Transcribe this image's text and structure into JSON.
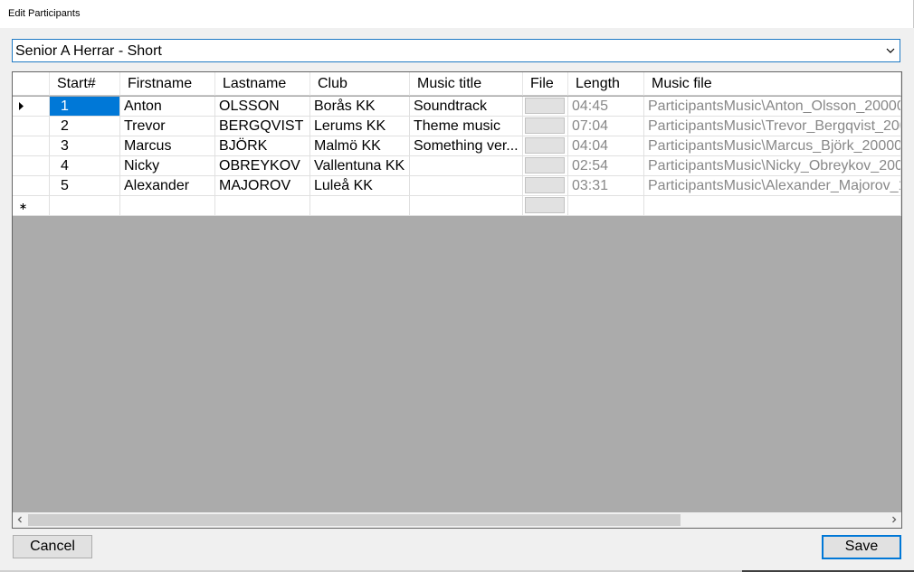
{
  "window": {
    "title": "Edit Participants"
  },
  "category": {
    "selected": "Senior A Herrar - Short"
  },
  "grid": {
    "columns": [
      "Start#",
      "Firstname",
      "Lastname",
      "Club",
      "Music title",
      "File",
      "Length",
      "Music file"
    ],
    "rows": [
      {
        "start": "1",
        "first": "Anton",
        "last": "OLSSON",
        "club": "Borås KK",
        "music_title": "Soundtrack",
        "length": "04:45",
        "music_file": "ParticipantsMusic\\Anton_Olsson_20000"
      },
      {
        "start": "2",
        "first": "Trevor",
        "last": "BERGQVIST",
        "club": "Lerums KK",
        "music_title": "Theme music",
        "length": "07:04",
        "music_file": "ParticipantsMusic\\Trevor_Bergqvist_200"
      },
      {
        "start": "3",
        "first": "Marcus",
        "last": "BJÖRK",
        "club": "Malmö KK",
        "music_title": "Something ver...",
        "length": "04:04",
        "music_file": "ParticipantsMusic\\Marcus_Björk_20000"
      },
      {
        "start": "4",
        "first": "Nicky",
        "last": "OBREYKOV",
        "club": "Vallentuna KK",
        "music_title": "",
        "length": "02:54",
        "music_file": "ParticipantsMusic\\Nicky_Obreykov_2000"
      },
      {
        "start": "5",
        "first": "Alexander",
        "last": "MAJOROV",
        "club": "Luleå KK",
        "music_title": "",
        "length": "03:31",
        "music_file": "ParticipantsMusic\\Alexander_Majorov_1"
      }
    ]
  },
  "buttons": {
    "cancel": "Cancel",
    "save": "Save"
  },
  "colors": {
    "selection": "#0078d7",
    "grid_background": "#ababab",
    "disabled_text": "#888888"
  }
}
